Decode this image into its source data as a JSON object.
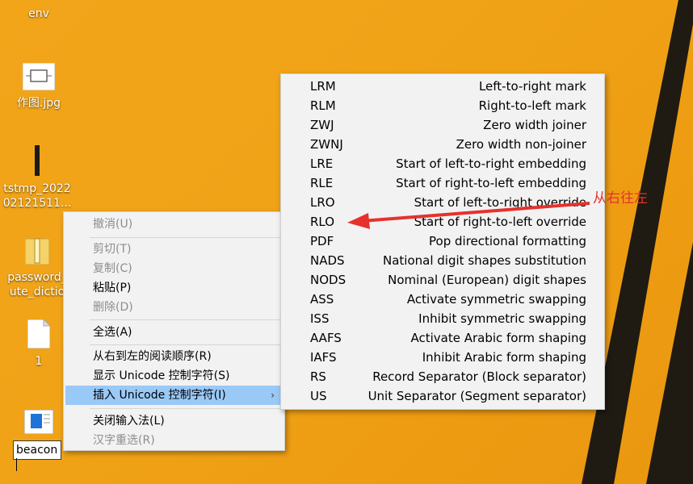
{
  "desktop": {
    "icons": [
      {
        "label": "env"
      },
      {
        "label": "作图.jpg"
      },
      {
        "label_line1": "tstmp_2022",
        "label_line2": "02121511..."
      },
      {
        "label_line1": "password_",
        "label_line2": "ute_dictio"
      },
      {
        "label": "1"
      }
    ],
    "rename_value": "beacon"
  },
  "context_menu": {
    "undo": "撤消(U)",
    "cut": "剪切(T)",
    "copy": "复制(C)",
    "paste": "粘贴(P)",
    "delete": "删除(D)",
    "select_all": "全选(A)",
    "rtl_order": "从右到左的阅读顺序(R)",
    "show_unicode": "显示 Unicode 控制字符(S)",
    "insert_unicode": "插入 Unicode 控制字符(I)",
    "close_ime": "关闭输入法(L)",
    "reconvert": "汉字重选(R)",
    "submenu_arrow": "›"
  },
  "unicode_submenu": [
    {
      "code": "LRM",
      "desc": "Left-to-right mark"
    },
    {
      "code": "RLM",
      "desc": "Right-to-left mark"
    },
    {
      "code": "ZWJ",
      "desc": "Zero width joiner"
    },
    {
      "code": "ZWNJ",
      "desc": "Zero width non-joiner"
    },
    {
      "code": "LRE",
      "desc": "Start of left-to-right embedding"
    },
    {
      "code": "RLE",
      "desc": "Start of right-to-left embedding"
    },
    {
      "code": "LRO",
      "desc": "Start of left-to-right override"
    },
    {
      "code": "RLO",
      "desc": "Start of right-to-left override"
    },
    {
      "code": "PDF",
      "desc": "Pop directional formatting"
    },
    {
      "code": "NADS",
      "desc": "National digit shapes substitution"
    },
    {
      "code": "NODS",
      "desc": "Nominal (European) digit shapes"
    },
    {
      "code": "ASS",
      "desc": "Activate symmetric swapping"
    },
    {
      "code": "ISS",
      "desc": "Inhibit symmetric swapping"
    },
    {
      "code": "AAFS",
      "desc": "Activate Arabic form shaping"
    },
    {
      "code": "IAFS",
      "desc": "Inhibit Arabic form shaping"
    },
    {
      "code": "RS",
      "desc": "Record Separator (Block separator)"
    },
    {
      "code": "US",
      "desc": "Unit Separator (Segment separator)"
    }
  ],
  "annotation": {
    "text": "从右往左",
    "color": "#e5322c"
  },
  "colors": {
    "menu_bg": "#f2f2f2",
    "highlight": "#99c9f7",
    "desktop": "#f0a317"
  }
}
